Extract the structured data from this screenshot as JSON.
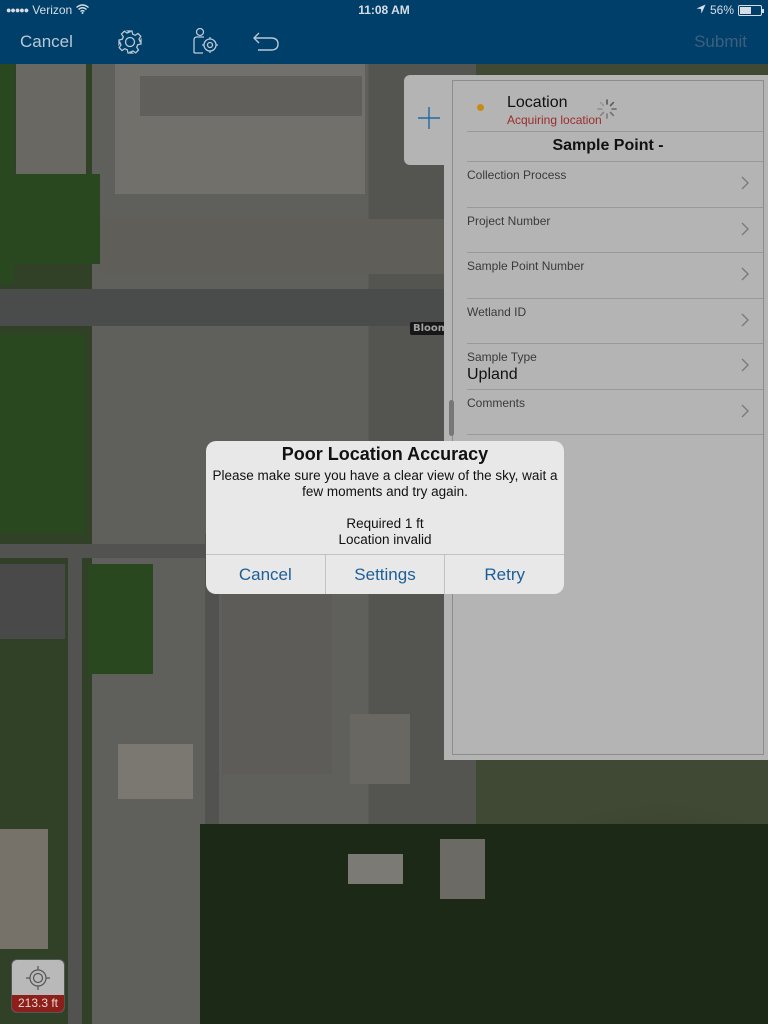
{
  "status_bar": {
    "carrier": "Verizon",
    "time": "11:08 AM",
    "battery_percent_label": "56%",
    "battery_level": 0.56
  },
  "nav": {
    "cancel_label": "Cancel",
    "submit_label": "Submit",
    "icons": [
      "gear-icon",
      "person-settings-icon",
      "undo-icon"
    ]
  },
  "map": {
    "label": "Bloom"
  },
  "form": {
    "location": {
      "title": "Location",
      "status": "Acquiring location",
      "status_color": "#9a2d2d",
      "dot_color": "#c88a14"
    },
    "section_title": "Sample Point  -",
    "fields": [
      {
        "label": "Collection Process",
        "value": ""
      },
      {
        "label": "Project Number",
        "value": ""
      },
      {
        "label": "Sample Point Number",
        "value": ""
      },
      {
        "label": "Wetland ID",
        "value": ""
      },
      {
        "label": "Sample Type",
        "value": "Upland"
      },
      {
        "label": "Comments",
        "value": ""
      }
    ]
  },
  "alert": {
    "title": "Poor Location Accuracy",
    "message": "Please make sure you have a clear view of the sky, wait a few moments and try again.",
    "required": "Required 1 ft",
    "validity": "Location invalid",
    "buttons": {
      "cancel": "Cancel",
      "settings": "Settings",
      "retry": "Retry"
    },
    "button_color": "#1e5e98"
  },
  "accuracy_badge": {
    "value": "213.3 ft",
    "color": "#8c1f1a"
  },
  "colors": {
    "nav_background": "#003f6a"
  }
}
